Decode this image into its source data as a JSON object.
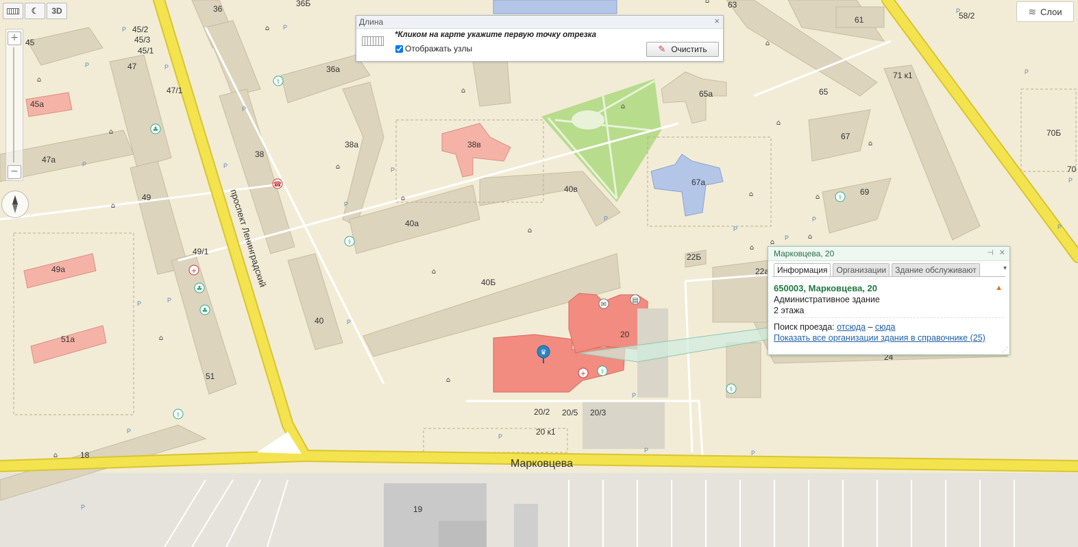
{
  "toolbar": {
    "ruler_icon": "ruler-icon",
    "night_icon": "moon-icon",
    "btn_3d": "3D"
  },
  "zoom": {
    "plus": "+",
    "minus": "−"
  },
  "layers": {
    "icon": "layers-icon",
    "label": "Слои"
  },
  "length_dialog": {
    "title": "Длина",
    "close": "×",
    "hint": "*Кликом на карте укажите первую точку отрезка",
    "show_nodes_label": "Отображать узлы",
    "show_nodes_checked": true,
    "clear_label": "Очистить"
  },
  "popup": {
    "title": "Марковцева, 20",
    "tabs": [
      "Информация",
      "Организации",
      "Здание обслуживают"
    ],
    "active_tab": "Информация",
    "address": "650003, Марковцева, 20",
    "building_type": "Административное здание",
    "floors": "2 этажа",
    "route_label": "Поиск проезда:",
    "route_from": "отсюда",
    "route_dash": "–",
    "route_to": "сюда",
    "show_all": "Показать все организации здания в справочнике",
    "count": "(25)"
  },
  "streets": {
    "main_horizontal": "Марковцева",
    "main_vertical": "проспект Ленинградский"
  },
  "building_labels": [
    {
      "id": "36",
      "text": "36"
    },
    {
      "id": "36b",
      "text": "36Б"
    },
    {
      "id": "36a",
      "text": "36а"
    },
    {
      "id": "38",
      "text": "38"
    },
    {
      "id": "38a",
      "text": "38а"
    },
    {
      "id": "38v",
      "text": "38в"
    },
    {
      "id": "40",
      "text": "40"
    },
    {
      "id": "40a",
      "text": "40а"
    },
    {
      "id": "40b",
      "text": "40Б"
    },
    {
      "id": "40v",
      "text": "40в"
    },
    {
      "id": "45",
      "text": "45"
    },
    {
      "id": "45_2",
      "text": "45/2"
    },
    {
      "id": "45_3",
      "text": "45/3"
    },
    {
      "id": "45_1",
      "text": "45/1"
    },
    {
      "id": "45a",
      "text": "45а"
    },
    {
      "id": "47",
      "text": "47"
    },
    {
      "id": "47_1",
      "text": "47/1"
    },
    {
      "id": "47a",
      "text": "47а"
    },
    {
      "id": "49",
      "text": "49"
    },
    {
      "id": "49_1",
      "text": "49/1"
    },
    {
      "id": "49a",
      "text": "49а"
    },
    {
      "id": "51",
      "text": "51"
    },
    {
      "id": "51a",
      "text": "51а"
    },
    {
      "id": "18",
      "text": "18"
    },
    {
      "id": "19",
      "text": "19"
    },
    {
      "id": "20",
      "text": "20"
    },
    {
      "id": "20_2",
      "text": "20/2"
    },
    {
      "id": "20_5",
      "text": "20/5"
    },
    {
      "id": "20_3",
      "text": "20/3"
    },
    {
      "id": "20k1",
      "text": "20 к1"
    },
    {
      "id": "22a",
      "text": "22а"
    },
    {
      "id": "22b",
      "text": "22Б"
    },
    {
      "id": "24",
      "text": "24"
    },
    {
      "id": "58_2",
      "text": "58/2"
    },
    {
      "id": "61",
      "text": "61"
    },
    {
      "id": "63",
      "text": "63"
    },
    {
      "id": "65",
      "text": "65"
    },
    {
      "id": "65a",
      "text": "65а"
    },
    {
      "id": "67",
      "text": "67"
    },
    {
      "id": "67a",
      "text": "67а"
    },
    {
      "id": "69",
      "text": "69"
    },
    {
      "id": "70b",
      "text": "70Б"
    },
    {
      "id": "70",
      "text": "70"
    },
    {
      "id": "71k1",
      "text": "71 к1"
    }
  ],
  "colors": {
    "road": "#f3e34e",
    "road_edge": "#d9c430",
    "ground": "#f2ecd6",
    "building": "#dcd4bd",
    "highlight": "#f28b80",
    "park": "#b7dc8c",
    "popup_green": "#1f7a3e",
    "link_blue": "#1f5fa6"
  }
}
